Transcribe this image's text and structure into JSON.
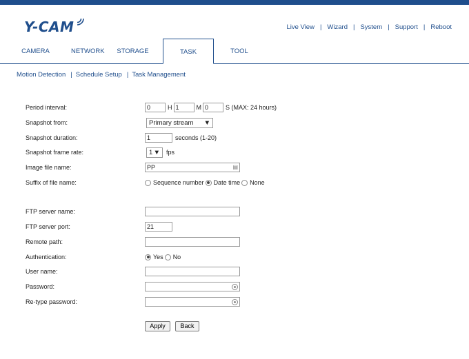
{
  "brand": {
    "logo_text": "Y-CAM"
  },
  "header_links": [
    "Live View",
    "Wizard",
    "System",
    "Support",
    "Reboot"
  ],
  "tabs": [
    "CAMERA",
    "NETWORK",
    "STORAGE",
    "TASK",
    "TOOL"
  ],
  "active_tab": "TASK",
  "subnav": [
    "Motion Detection",
    "Schedule Setup",
    "Task Management"
  ],
  "form": {
    "period_interval": {
      "label": "Period interval:",
      "hours": "0",
      "h_unit": "H",
      "minutes": "1",
      "m_unit": "M",
      "seconds": "0",
      "s_unit": "S (MAX: 24 hours)"
    },
    "snapshot_from": {
      "label": "Snapshot from:",
      "value": "Primary stream"
    },
    "snapshot_duration": {
      "label": "Snapshot duration:",
      "value": "1",
      "unit": "seconds (1-20)"
    },
    "snapshot_frame_rate": {
      "label": "Snapshot frame rate:",
      "value": "1",
      "unit": "fps"
    },
    "image_file_name": {
      "label": "Image file name:",
      "value": "PP"
    },
    "suffix": {
      "label": "Suffix of file name:",
      "options": [
        "Sequence number",
        "Date time",
        "None"
      ],
      "selected": "Date time"
    },
    "ftp_server_name": {
      "label": "FTP server name:",
      "value": ""
    },
    "ftp_server_port": {
      "label": "FTP server port:",
      "value": "21"
    },
    "remote_path": {
      "label": "Remote path:",
      "value": ""
    },
    "authentication": {
      "label": "Authentication:",
      "options": [
        "Yes",
        "No"
      ],
      "selected": "Yes"
    },
    "user_name": {
      "label": "User name:",
      "value": ""
    },
    "password": {
      "label": "Password:",
      "value": ""
    },
    "retype_password": {
      "label": "Re-type password:",
      "value": ""
    }
  },
  "buttons": {
    "apply": "Apply",
    "back": "Back"
  },
  "colors": {
    "brand_blue": "#1f4e8c"
  }
}
